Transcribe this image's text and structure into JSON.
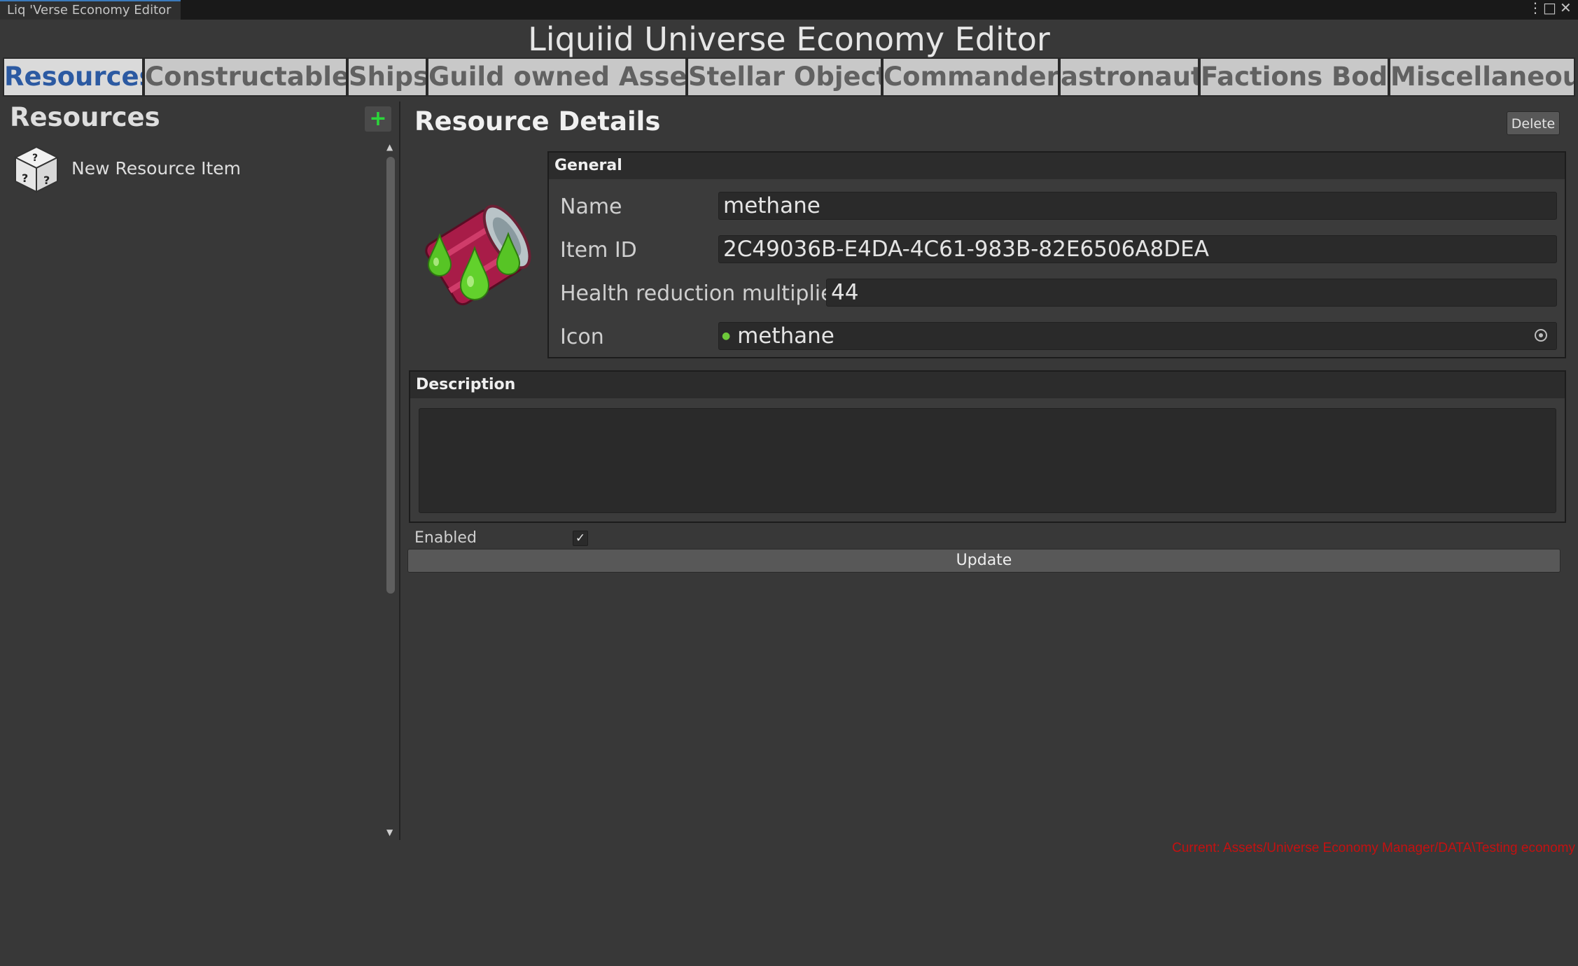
{
  "window": {
    "tab_title": "Liq 'Verse Economy Editor",
    "menu_icon": "kebab-menu-icon",
    "maximize_icon": "maximize-icon",
    "close_icon": "close-icon"
  },
  "app_title": "Liquiid Universe Economy Editor",
  "categories": [
    {
      "label": "Resources",
      "active": true
    },
    {
      "label": "Constructables"
    },
    {
      "label": "Ships"
    },
    {
      "label": "Guild owned Assets"
    },
    {
      "label": "Stellar Objects"
    },
    {
      "label": "Commanders"
    },
    {
      "label": "astronauts"
    },
    {
      "label": "Factions Body"
    },
    {
      "label": "Miscellaneous"
    }
  ],
  "left_panel": {
    "title": "Resources",
    "add_label": "+",
    "items": [
      {
        "label": "New Resource Item",
        "icon": "dice-icon"
      }
    ]
  },
  "details": {
    "title": "Resource Details",
    "delete_label": "Delete",
    "general": {
      "heading": "General",
      "name_label": "Name",
      "name_value": "methane",
      "id_label": "Item ID",
      "id_value": "2C49036B-E4DA-4C61-983B-82E6506A8DEA",
      "health_label": "Health reduction multiplier",
      "health_value": "44",
      "icon_label": "Icon",
      "icon_value": "methane"
    },
    "description": {
      "heading": "Description",
      "value": ""
    },
    "enabled_label": "Enabled",
    "enabled": true,
    "update_label": "Update"
  },
  "status_path": "Current: Assets/Universe Economy Manager/DATA\\Testing economy",
  "colors": {
    "accent_tab_text": "#2c5aa2",
    "add_plus": "#2bd63a",
    "status_path": "#c41111",
    "background": "#383838"
  }
}
